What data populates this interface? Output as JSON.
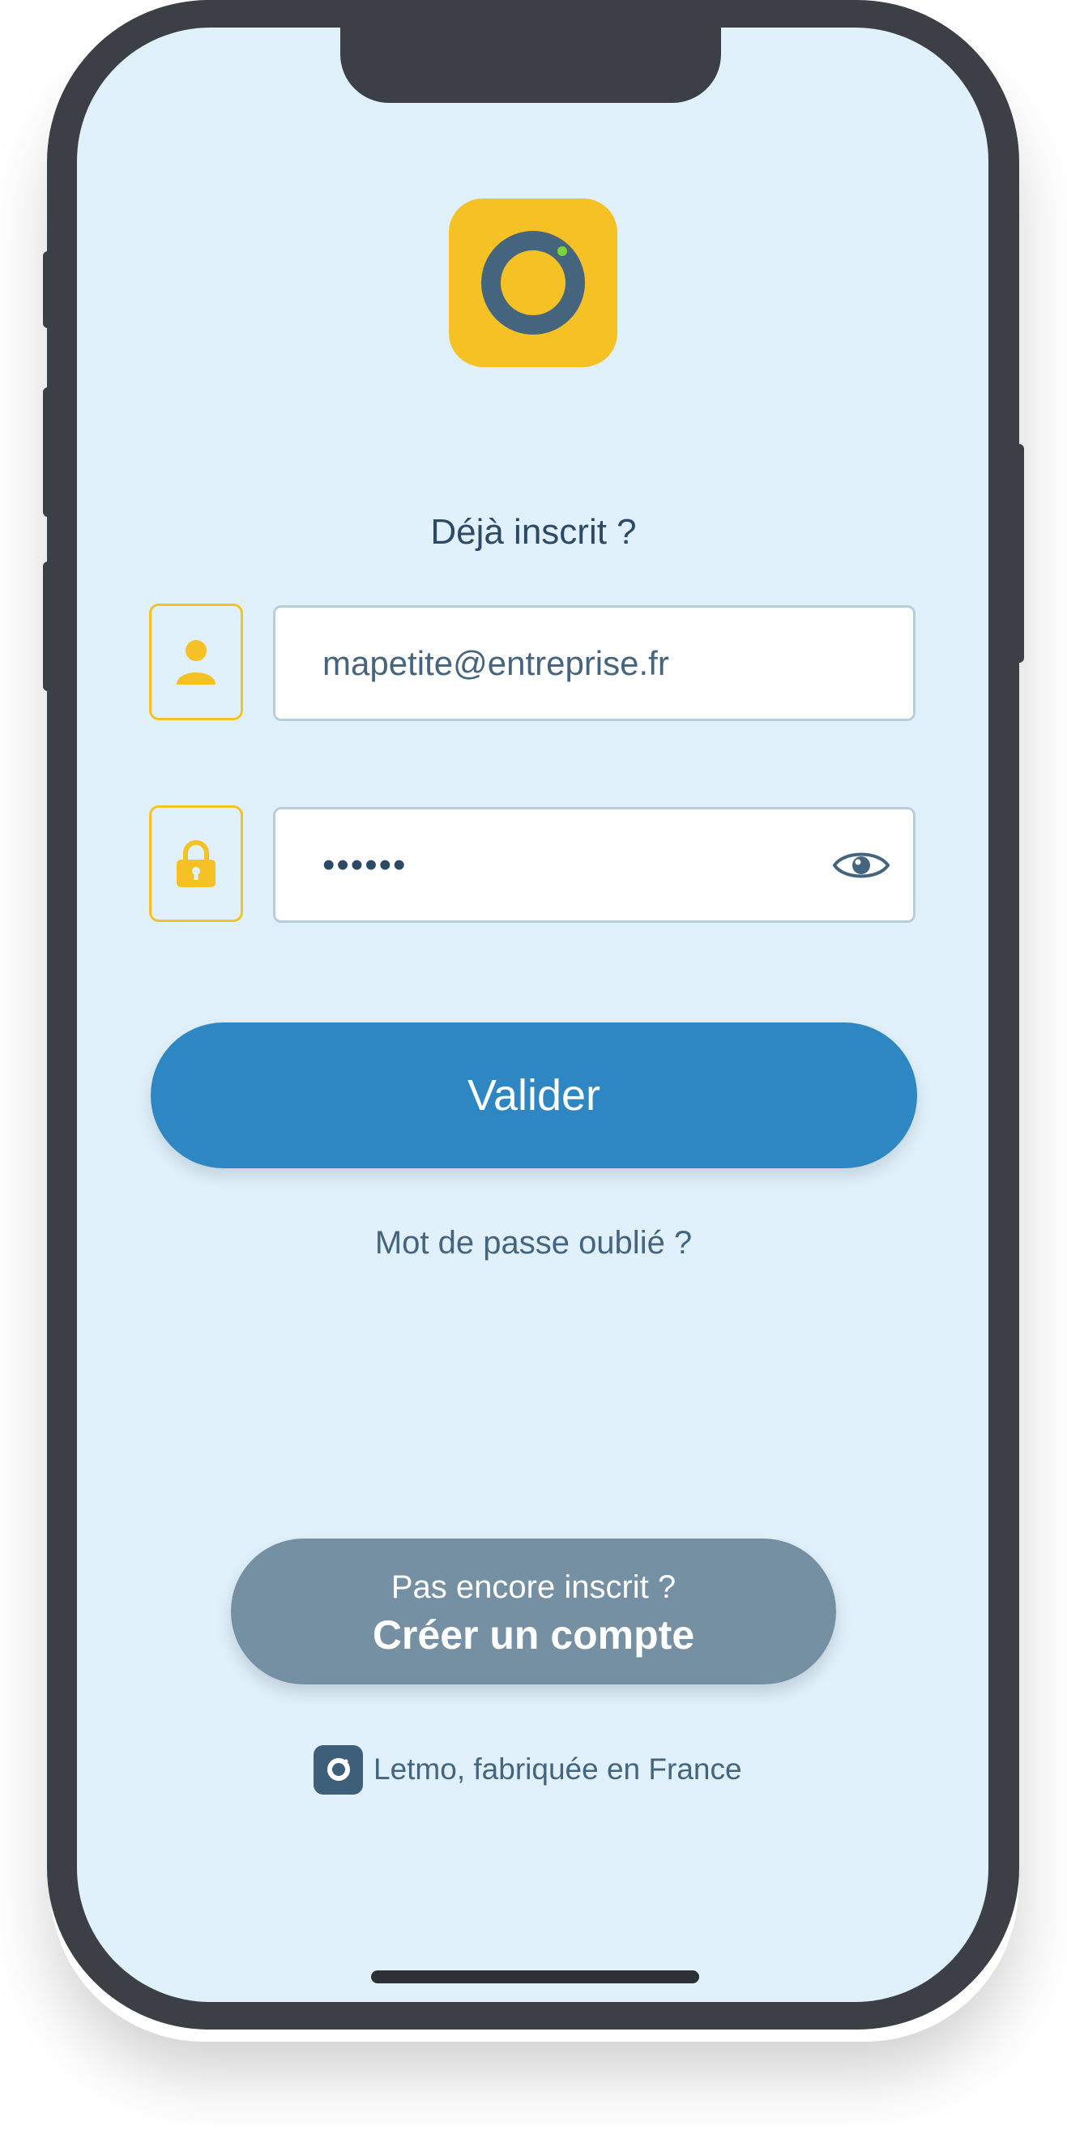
{
  "login": {
    "heading": "Déjà inscrit ?",
    "email_value": "mapetite@entreprise.fr",
    "password_value": "••••••",
    "validate_label": "Valider",
    "forgot_label": "Mot de passe oublié  ?"
  },
  "signup": {
    "prompt": "Pas encore inscrit ?",
    "cta": "Créer un compte"
  },
  "footer": {
    "text": "Letmo, fabriquée en France"
  },
  "colors": {
    "brand_yellow": "#f5c125",
    "brand_blue": "#2e87c3",
    "brand_dark": "#3d5f7a",
    "background": "#e0f1fc"
  },
  "icons": [
    "user-icon",
    "lock-icon",
    "eye-icon",
    "app-logo-icon"
  ]
}
